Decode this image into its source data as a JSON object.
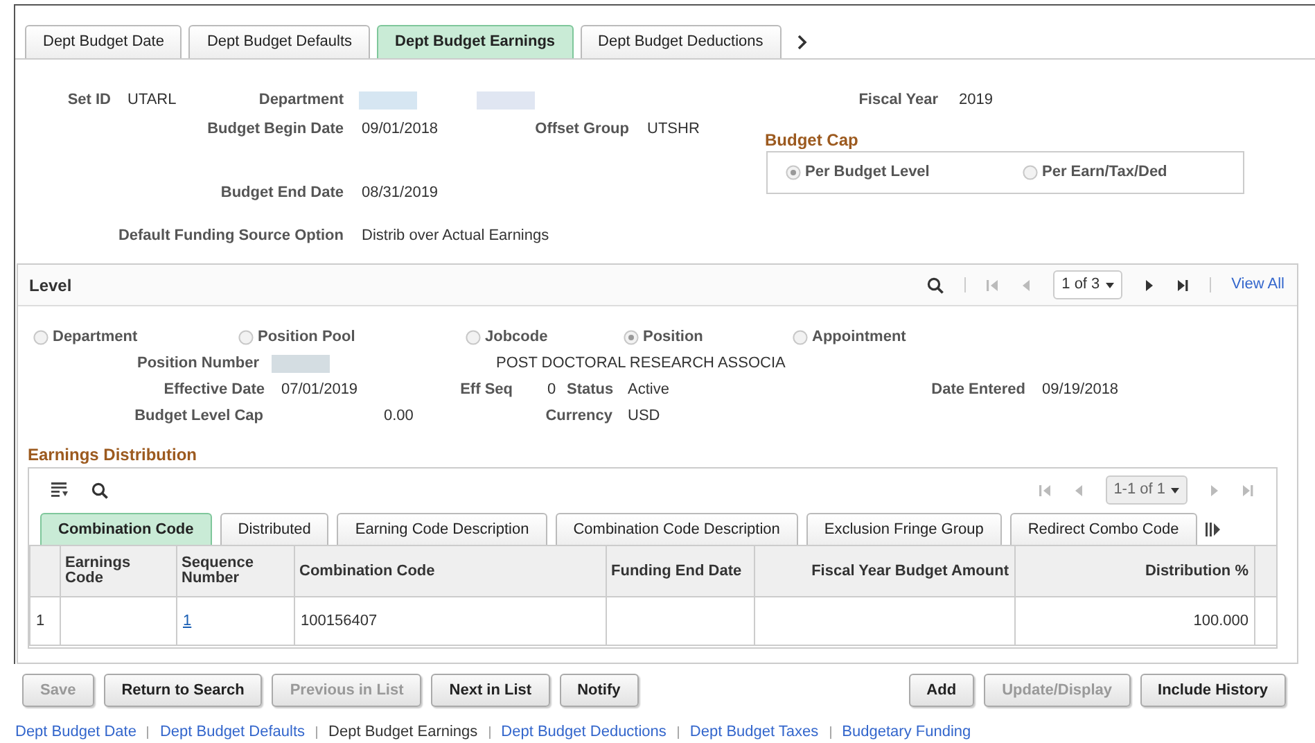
{
  "page_tabs": [
    {
      "label": "Dept Budget Date",
      "selected": false
    },
    {
      "label": "Dept Budget Defaults",
      "selected": false
    },
    {
      "label": "Dept Budget Earnings",
      "selected": true
    },
    {
      "label": "Dept Budget Deductions",
      "selected": false
    }
  ],
  "header": {
    "set_id": {
      "label": "Set ID",
      "value": "UTARL"
    },
    "department": {
      "label": "Department"
    },
    "fiscal_year": {
      "label": "Fiscal Year",
      "value": "2019"
    },
    "budget_begin_date": {
      "label": "Budget Begin Date",
      "value": "09/01/2018"
    },
    "offset_group": {
      "label": "Offset Group",
      "value": "UTSHR"
    },
    "budget_end_date": {
      "label": "Budget End Date",
      "value": "08/31/2019"
    },
    "default_funding_source_option": {
      "label": "Default Funding Source Option",
      "value": "Distrib over Actual Earnings"
    }
  },
  "budget_cap": {
    "title": "Budget Cap",
    "options": [
      {
        "label": "Per Budget Level",
        "selected": true
      },
      {
        "label": "Per Earn/Tax/Ded",
        "selected": false
      }
    ]
  },
  "level": {
    "title": "Level",
    "page_select": "1 of 3",
    "view_all": "View All",
    "navigation": [
      {
        "kind": "first",
        "disabled": true
      },
      {
        "kind": "previous",
        "disabled": true
      },
      {
        "kind": "next",
        "disabled": false
      },
      {
        "kind": "last",
        "disabled": false
      }
    ],
    "levels": [
      {
        "label": "Department",
        "selected": false
      },
      {
        "label": "Position Pool",
        "selected": false
      },
      {
        "label": "Jobcode",
        "selected": false
      },
      {
        "label": "Position",
        "selected": true
      },
      {
        "label": "Appointment",
        "selected": false
      }
    ],
    "position_number": {
      "label": "Position Number"
    },
    "position_description": "POST DOCTORAL RESEARCH ASSOCIA",
    "effective_date": {
      "label": "Effective Date",
      "value": "07/01/2019"
    },
    "eff_seq": {
      "label": "Eff Seq",
      "value": "0"
    },
    "status": {
      "label": "Status",
      "value": "Active"
    },
    "date_entered": {
      "label": "Date Entered",
      "value": "09/19/2018"
    },
    "budget_level_cap": {
      "label": "Budget Level Cap",
      "value": "0.00"
    },
    "currency": {
      "label": "Currency",
      "value": "USD"
    }
  },
  "earnings_distribution": {
    "title": "Earnings Distribution",
    "page_select": "1-1 of 1",
    "navigation": [
      {
        "kind": "first",
        "disabled": true
      },
      {
        "kind": "previous",
        "disabled": true
      },
      {
        "kind": "next",
        "disabled": true
      },
      {
        "kind": "last",
        "disabled": true
      }
    ],
    "tabs": [
      {
        "label": "Combination Code",
        "selected": true
      },
      {
        "label": "Distributed",
        "selected": false
      },
      {
        "label": "Earning Code Description",
        "selected": false
      },
      {
        "label": "Combination Code Description",
        "selected": false
      },
      {
        "label": "Exclusion Fringe Group",
        "selected": false
      },
      {
        "label": "Redirect Combo Code",
        "selected": false
      }
    ],
    "columns": [
      "Earnings Code",
      "Sequence Number",
      "Combination Code",
      "Funding End Date",
      "Fiscal Year Budget Amount",
      "Distribution %"
    ],
    "rows": [
      {
        "row_number": "1",
        "sequence_number": "1",
        "combination_code": "100156407",
        "distribution_percent": "100.000"
      }
    ]
  },
  "buttons_left": [
    {
      "label": "Save",
      "disabled": true
    },
    {
      "label": "Return to Search",
      "disabled": false
    },
    {
      "label": "Previous in List",
      "disabled": true
    },
    {
      "label": "Next in List",
      "disabled": false
    },
    {
      "label": "Notify",
      "disabled": false
    }
  ],
  "buttons_right": [
    {
      "label": "Add",
      "disabled": false
    },
    {
      "label": "Update/Display",
      "disabled": true
    },
    {
      "label": "Include History",
      "disabled": false
    }
  ],
  "footer_links": [
    {
      "label": "Dept Budget Date",
      "current": false
    },
    {
      "label": "Dept Budget Defaults",
      "current": false
    },
    {
      "label": "Dept Budget Earnings",
      "current": true
    },
    {
      "label": "Dept Budget Deductions",
      "current": false
    },
    {
      "label": "Dept Budget Taxes",
      "current": false
    },
    {
      "label": "Budgetary Funding",
      "current": false
    }
  ]
}
